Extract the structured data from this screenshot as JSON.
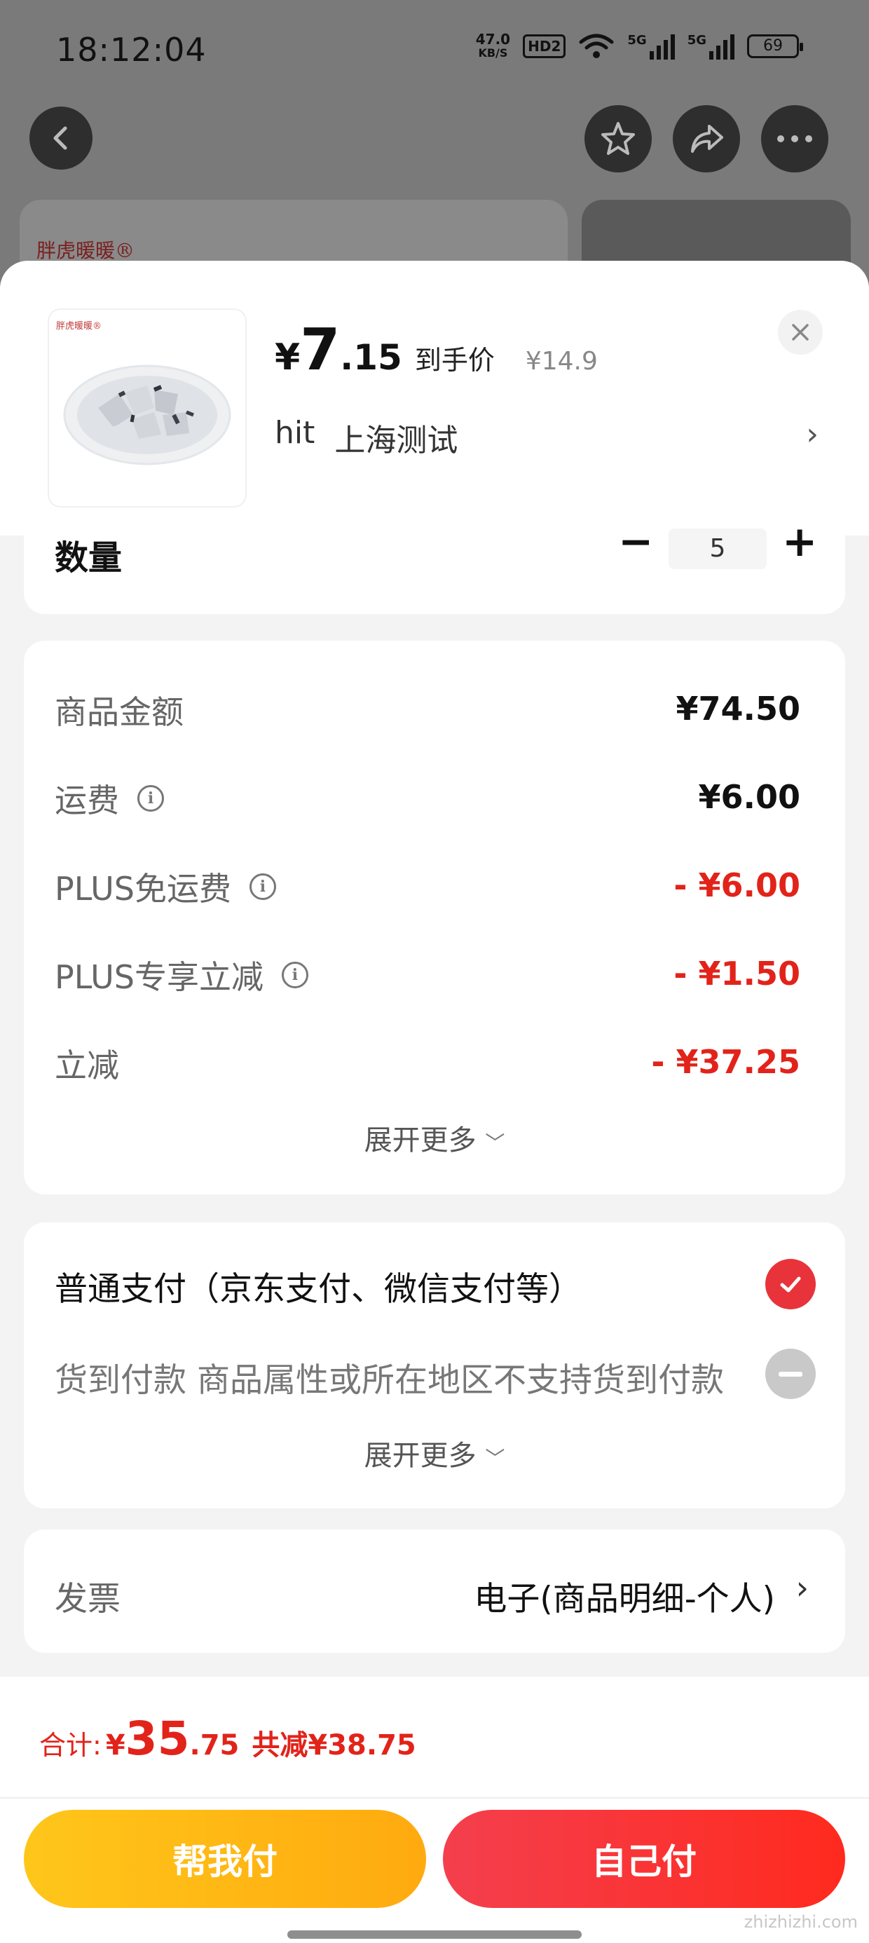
{
  "status_bar": {
    "time": "18:12:04",
    "net_speed_value": "47.0",
    "net_speed_unit": "KB/S",
    "hd": "HD2",
    "signal1": "5G",
    "signal2": "5G",
    "battery": "69"
  },
  "background": {
    "brand": "胖虎暖暖®"
  },
  "product": {
    "brand_small": "胖虎暖暖®",
    "currency": "¥",
    "price_int": "7",
    "price_dec": ".15",
    "price_tag": "到手价",
    "original_price": "¥14.9",
    "address_name": "hit",
    "address_city": "上海测试"
  },
  "quantity": {
    "label": "数量",
    "value": "5"
  },
  "fees": {
    "rows": [
      {
        "label": "商品金额",
        "value": "¥74.50"
      },
      {
        "label": "运费",
        "value": "¥6.00"
      },
      {
        "label": "PLUS免运费",
        "value": "- ¥6.00"
      },
      {
        "label": "PLUS专享立减",
        "value": "- ¥1.50"
      },
      {
        "label": "立减",
        "value": "- ¥37.25"
      }
    ],
    "expand": "展开更多"
  },
  "payment": {
    "option1": "普通支付（京东支付、微信支付等）",
    "option2": "货到付款 商品属性或所在地区不支持货到付款",
    "expand": "展开更多"
  },
  "invoice": {
    "label": "发票",
    "value": "电子(商品明细-个人)"
  },
  "total": {
    "label": "合计:",
    "currency": "¥",
    "int": "35",
    "dec": ".75",
    "saving": "共减¥38.75"
  },
  "buttons": {
    "help_pay": "帮我付",
    "self_pay": "自己付"
  },
  "watermark": "zhizhizhi.com",
  "colors": {
    "accent_red": "#e2231a",
    "button_yellow": "#ffc61a",
    "button_red": "#f43f4e"
  }
}
